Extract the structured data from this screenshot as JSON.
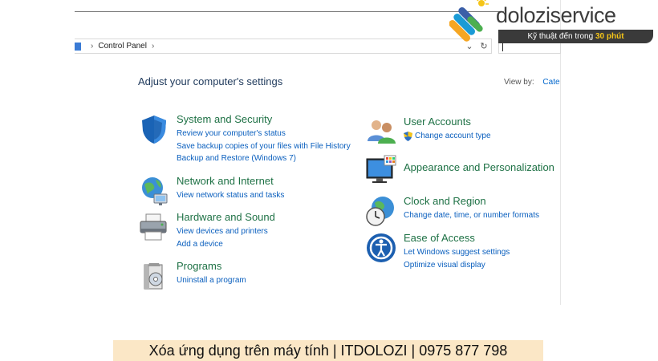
{
  "address_bar": {
    "path": [
      "Control Panel"
    ],
    "dropdown_glyph": "⌄",
    "refresh_glyph": "↻"
  },
  "header": {
    "title": "Adjust your computer's settings",
    "view_by_label": "View by:",
    "view_by_value": "Categ"
  },
  "left_column": [
    {
      "icon": "shield-icon",
      "title": "System and Security",
      "links": [
        "Review your computer's status",
        "Save backup copies of your files with File History",
        "Backup and Restore (Windows 7)"
      ]
    },
    {
      "icon": "network-globe-icon",
      "title": "Network and Internet",
      "links": [
        "View network status and tasks"
      ]
    },
    {
      "icon": "printer-icon",
      "title": "Hardware and Sound",
      "links": [
        "View devices and printers",
        "Add a device"
      ]
    },
    {
      "icon": "programs-disc-icon",
      "title": "Programs",
      "links": [
        "Uninstall a program"
      ]
    }
  ],
  "right_column": [
    {
      "icon": "users-icon",
      "title": "User Accounts",
      "links": [
        "Change account type"
      ]
    },
    {
      "icon": "monitor-icon",
      "title": "Appearance and Personalization",
      "links": []
    },
    {
      "icon": "clock-globe-icon",
      "title": "Clock and Region",
      "links": [
        "Change date, time, or number formats"
      ]
    },
    {
      "icon": "ease-of-access-icon",
      "title": "Ease of Access",
      "links": [
        "Let Windows suggest settings",
        "Optimize visual display"
      ]
    }
  ],
  "brand": {
    "name": "doloziservice",
    "tagline_prefix": "Kỹ thuật đến trong",
    "tagline_highlight": "30 phút"
  },
  "caption": "Xóa ứng dụng trên máy tính | ITDOLOZI | 0975 877 798",
  "colors": {
    "category_title": "#1e7145",
    "link": "#0a5fbe",
    "heading": "#1e395b",
    "caption_bg": "#fbe7c6",
    "tagline_bg": "#3a3a3a",
    "tagline_highlight": "#f5c518"
  }
}
